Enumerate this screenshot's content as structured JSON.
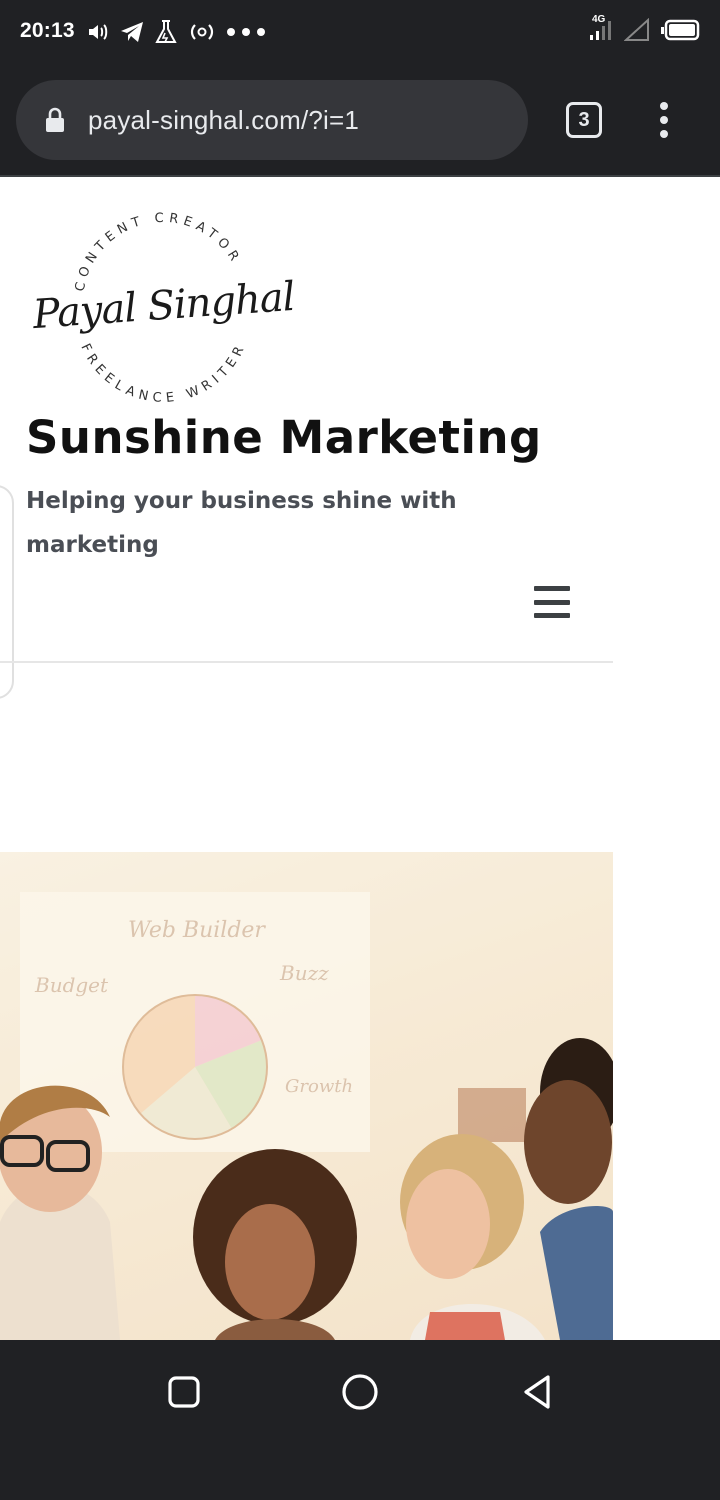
{
  "status_bar": {
    "time": "20:13",
    "network_label": "4G",
    "left_icons": [
      "volume-icon",
      "telegram-icon",
      "flask-icon",
      "hotspot-icon",
      "more-dots-icon"
    ],
    "right_icons": [
      "signal-icon",
      "signal-empty-icon",
      "battery-icon"
    ]
  },
  "browser": {
    "url": "payal-singhal.com/?i=1",
    "tab_count": "3"
  },
  "site": {
    "logo": {
      "name": "Payal Singhal",
      "arc_top": "CONTENT CREATOR",
      "arc_bottom": "FREELANCE WRITER"
    },
    "title": "Sunshine Marketing",
    "tagline": "Helping your business shine with marketing",
    "hero_whiteboard_words": [
      "Web Builder",
      "Budget",
      "Buzz",
      "Growth"
    ]
  },
  "colors": {
    "chrome_bg": "#202124",
    "omnibox_bg": "#35363a",
    "title_text": "#111111",
    "tagline_text": "#4a4e55"
  }
}
